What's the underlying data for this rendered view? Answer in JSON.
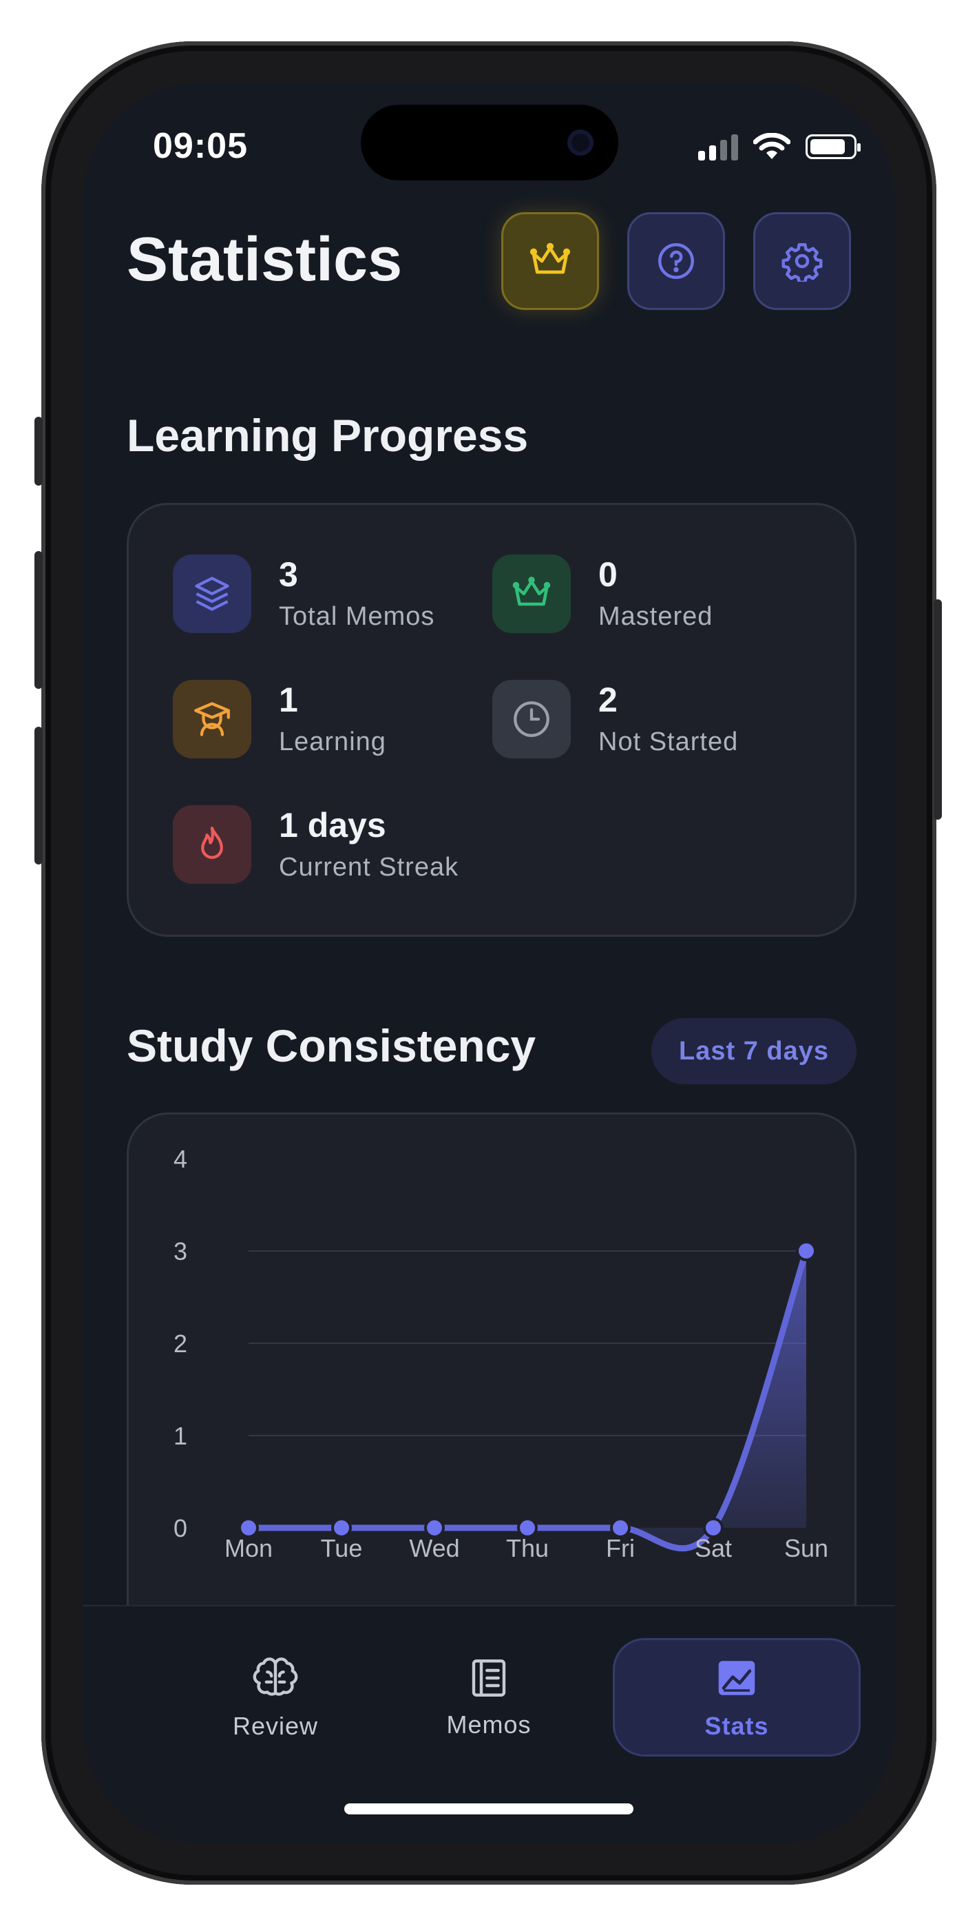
{
  "status_bar": {
    "time": "09:05"
  },
  "header": {
    "title": "Statistics"
  },
  "learning_progress": {
    "title": "Learning Progress",
    "stats": [
      {
        "value": "3",
        "label": "Total Memos",
        "icon": "layers-icon",
        "color": "#6f74e8"
      },
      {
        "value": "0",
        "label": "Mastered",
        "icon": "crown-icon",
        "color": "#31c07a"
      },
      {
        "value": "1",
        "label": "Learning",
        "icon": "graduation-icon",
        "color": "#f2a23a"
      },
      {
        "value": "2",
        "label": "Not Started",
        "icon": "clock-icon",
        "color": "#9aa0aa"
      },
      {
        "value": "1 days",
        "label": "Current Streak",
        "icon": "flame-icon",
        "color": "#ef5b5b"
      }
    ]
  },
  "study_consistency": {
    "title": "Study Consistency",
    "range_label": "Last 7 days"
  },
  "chart_data": {
    "type": "area",
    "categories": [
      "Mon",
      "Tue",
      "Wed",
      "Thu",
      "Fri",
      "Sat",
      "Sun"
    ],
    "values": [
      0,
      0,
      0,
      0,
      0,
      0,
      3
    ],
    "ylim": [
      0,
      4
    ],
    "y_ticks": [
      "0",
      "1",
      "2",
      "3",
      "4"
    ],
    "grid": true,
    "color": "#6066d8"
  },
  "tab_bar": {
    "tabs": [
      {
        "label": "Review",
        "icon": "brain-icon"
      },
      {
        "label": "Memos",
        "icon": "notebook-icon"
      },
      {
        "label": "Stats",
        "icon": "chart-image-icon",
        "active": true
      }
    ]
  },
  "colors": {
    "background": "#151a22",
    "card": "#1e2029",
    "accent": "#7379f2",
    "premium": "#f2c522"
  }
}
